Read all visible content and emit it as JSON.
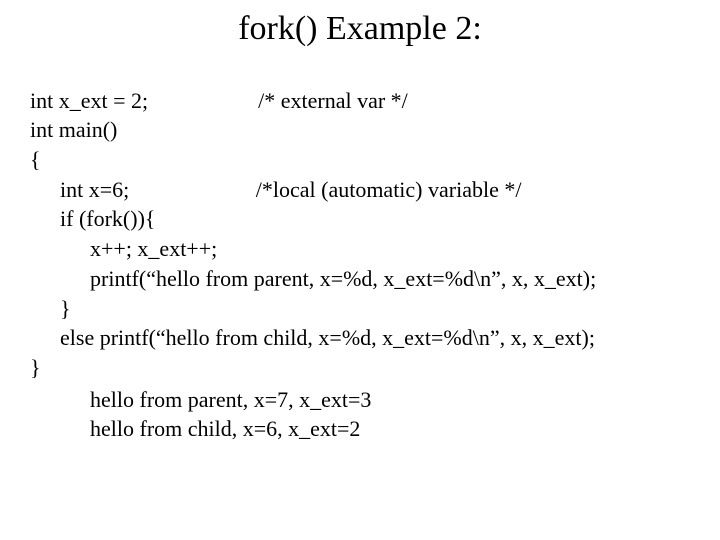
{
  "title": "fork() Example 2:",
  "code": {
    "l1_left": "int x_ext = 2;",
    "l1_right": "/* external var */",
    "l2": "int main()",
    "l3": "{",
    "l4_left": "int x=6;",
    "l4_right": "/*local (automatic) variable */",
    "l5": "if (fork()){",
    "l6": "x++; x_ext++;",
    "l7": "printf(“hello from parent, x=%d, x_ext=%d\\n”, x, x_ext);",
    "l8": "}",
    "l9": "else printf(“hello from child, x=%d, x_ext=%d\\n”, x, x_ext);",
    "l10": "}"
  },
  "output": {
    "o1": "hello from parent, x=7, x_ext=3",
    "o2": "hello from child, x=6, x_ext=2"
  }
}
